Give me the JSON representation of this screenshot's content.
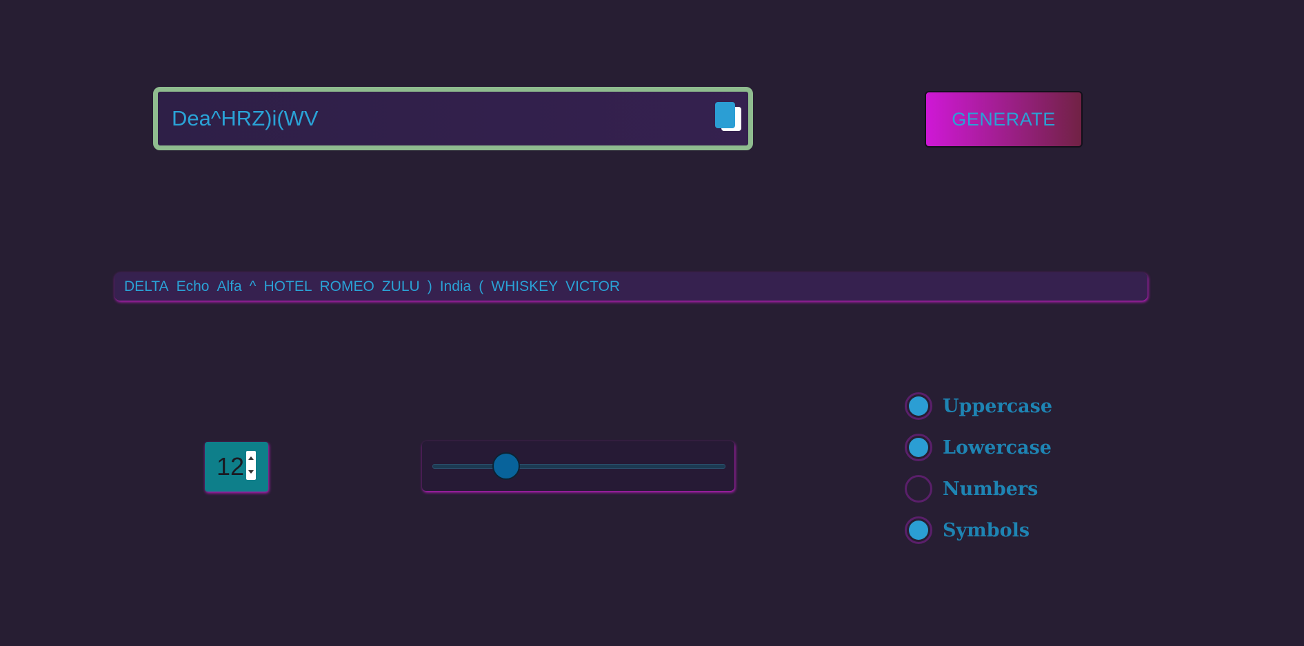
{
  "password": {
    "value": "Dea^HRZ)i(WV"
  },
  "generate_button": {
    "label": "GENERATE"
  },
  "phonetic": {
    "words": [
      "DELTA",
      "Echo",
      "Alfa",
      "^",
      "HOTEL",
      "ROMEO",
      "ZULU",
      ")",
      "India",
      "(",
      "WHISKEY",
      "VICTOR"
    ]
  },
  "length": {
    "value": "12",
    "slider_fraction": 0.25
  },
  "options": [
    {
      "label": "Uppercase",
      "checked": true
    },
    {
      "label": "Lowercase",
      "checked": true
    },
    {
      "label": "Numbers",
      "checked": false
    },
    {
      "label": "Symbols",
      "checked": true
    }
  ],
  "colors": {
    "background": "#271e33",
    "accent_text": "#2aa2d6",
    "field_border": "#8fbc8f",
    "button_gradient_start": "#cf18d6",
    "button_gradient_end": "#712245"
  },
  "icons": {
    "copy": "copy-icon"
  }
}
